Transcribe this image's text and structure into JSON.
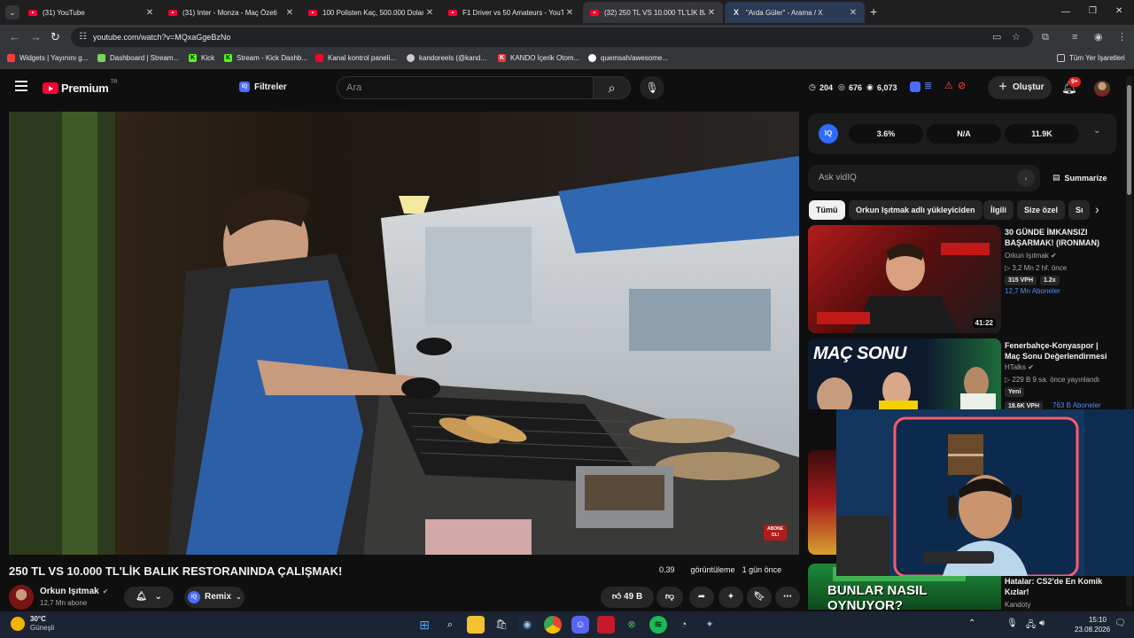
{
  "browser": {
    "tabs": [
      {
        "title": "(31) YouTube",
        "icon": "youtube-icon",
        "active": false
      },
      {
        "title": "(31) Inter - Monza - Maç Özeti",
        "icon": "youtube-icon",
        "active": false
      },
      {
        "title": "100 Polisten Kaç, 500.000 Dolar",
        "icon": "youtube-icon",
        "active": false
      },
      {
        "title": "F1 Driver vs 50 Amateurs - YouT",
        "icon": "youtube-icon",
        "active": false
      },
      {
        "title": "(32) 250 TL VS 10.000 TL'LİK BA",
        "icon": "youtube-icon",
        "active": true
      },
      {
        "title": "\"Arda Güler\" - Arama / X",
        "icon": "x-icon",
        "active": false
      }
    ],
    "new_tab": "+",
    "url": "youtube.com/watch?v=MQxaGgeBzNo",
    "bookmarks": [
      {
        "label": "Widgets | Yayınını g...",
        "color": "#ff3b3b"
      },
      {
        "label": "Dashboard | Stream...",
        "color": "#7cd35a"
      },
      {
        "label": "Kick",
        "color": "#53fc18"
      },
      {
        "label": "Stream - Kick Dashb...",
        "color": "#53fc18"
      },
      {
        "label": "Kanal kontrol paneli...",
        "color": "#ff0033"
      },
      {
        "label": "kandoreels (@kand...",
        "color": "#cccccc"
      },
      {
        "label": "KANDO İçerik Otom...",
        "color": "#e23b3b"
      },
      {
        "label": "quemsah/awesome...",
        "color": "#ffffff"
      }
    ],
    "all_bookmarks": "Tüm Yer İşaretleri"
  },
  "youtube": {
    "logo_text": "Premium",
    "logo_badge": "TR",
    "filters_label": "Filtreler",
    "search_placeholder": "Ara",
    "stats": [
      "204",
      "676",
      "6,073"
    ],
    "create_label": "Oluştur",
    "notif_badge": "9+",
    "video": {
      "title": "250 TL VS 10.000 TL'LİK BALIK RESTORANINDA ÇALIŞMAK!",
      "views_label": "0.39",
      "views_text": "görüntüleme",
      "age": "1 gün önce",
      "overlay_tag": "ABONE OL!"
    },
    "channel": {
      "name": "Orkun Işıtmak",
      "subs": "12,7 Mn abone",
      "remix_label": "Remix",
      "likes": "49 B"
    },
    "vidiq": {
      "logo": "IQ",
      "stats": [
        "3.6%",
        "N/A",
        "11.9K"
      ],
      "ask_placeholder": "Ask vidIQ",
      "summarize_label": "Summarize"
    },
    "chips": [
      "Tümü",
      "Orkun Işıtmak adlı yükleyiciden",
      "İlgili",
      "Size özel",
      "Sı"
    ],
    "recommendations": [
      {
        "title": "30 GÜNDE İMKANSIZI BAŞARMAK! (IRONMAN)",
        "channel": "Orkun Işıtmak",
        "meta": "3,2 Mn  2 hf. önce",
        "badges": [
          "315 VPH",
          "1.2x"
        ],
        "subs": "12,7 Mn Aboneler",
        "duration": "41:22"
      },
      {
        "title": "Fenerbahçe-Konyaspor | Maç Sonu Değerlendirmesi",
        "channel": "HTalks",
        "meta": "229 B  9 sa. önce yayınlandı",
        "new": "Yeni",
        "badges": [
          "18.6K VPH"
        ],
        "subs": "763 B Aboneler",
        "thumb_text": "MAÇ SONU"
      },
      {
        "title": "Hatalar: CS2'de En Komik Kızlar!",
        "channel": "Kandoty",
        "thumb_text": "BUNLAR NASIL OYNUYOR?"
      }
    ]
  },
  "taskbar": {
    "temp": "30°C",
    "weather": "Güneşli",
    "time": "15:10",
    "date": "23.08.2026"
  }
}
